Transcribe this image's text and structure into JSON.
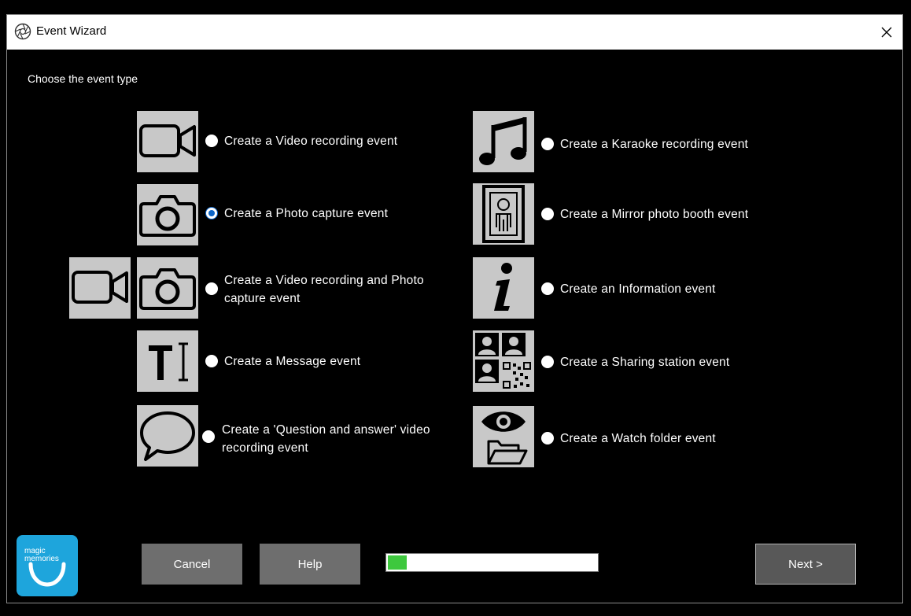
{
  "window": {
    "title": "Event Wizard",
    "close_glyph": "✕"
  },
  "prompt": "Choose the event type",
  "options": [
    {
      "label": "Create a Video recording event",
      "icon": "video-camera-icon",
      "selected": false
    },
    {
      "label": "Create a Photo capture event",
      "icon": "photo-camera-icon",
      "selected": true
    },
    {
      "label": "Create a Video recording and Photo capture event",
      "icon": "video-and-photo-icon",
      "selected": false
    },
    {
      "label": "Create a Message event",
      "icon": "text-cursor-icon",
      "selected": false
    },
    {
      "label": "Create a 'Question and answer' video recording event",
      "icon": "speech-bubble-icon",
      "selected": false
    },
    {
      "label": "Create a Karaoke recording event",
      "icon": "music-note-icon",
      "selected": false
    },
    {
      "label": "Create a Mirror photo booth event",
      "icon": "mirror-booth-icon",
      "selected": false
    },
    {
      "label": "Create an Information event",
      "icon": "info-icon",
      "selected": false
    },
    {
      "label": "Create a Sharing station event",
      "icon": "sharing-qr-icon",
      "selected": false
    },
    {
      "label": "Create a Watch folder event",
      "icon": "eye-folder-icon",
      "selected": false
    }
  ],
  "footer": {
    "logo_text": "magic memories",
    "cancel_label": "Cancel",
    "help_label": "Help",
    "next_label": "Next >",
    "progress": 0.09
  },
  "colors": {
    "background": "#000000",
    "icon_tile": "#c8c8c8",
    "radio_selected": "#0a64c8",
    "progress_fill": "#3ec83e",
    "logo": "#1ea5dc",
    "button": "#6e6e6e"
  }
}
